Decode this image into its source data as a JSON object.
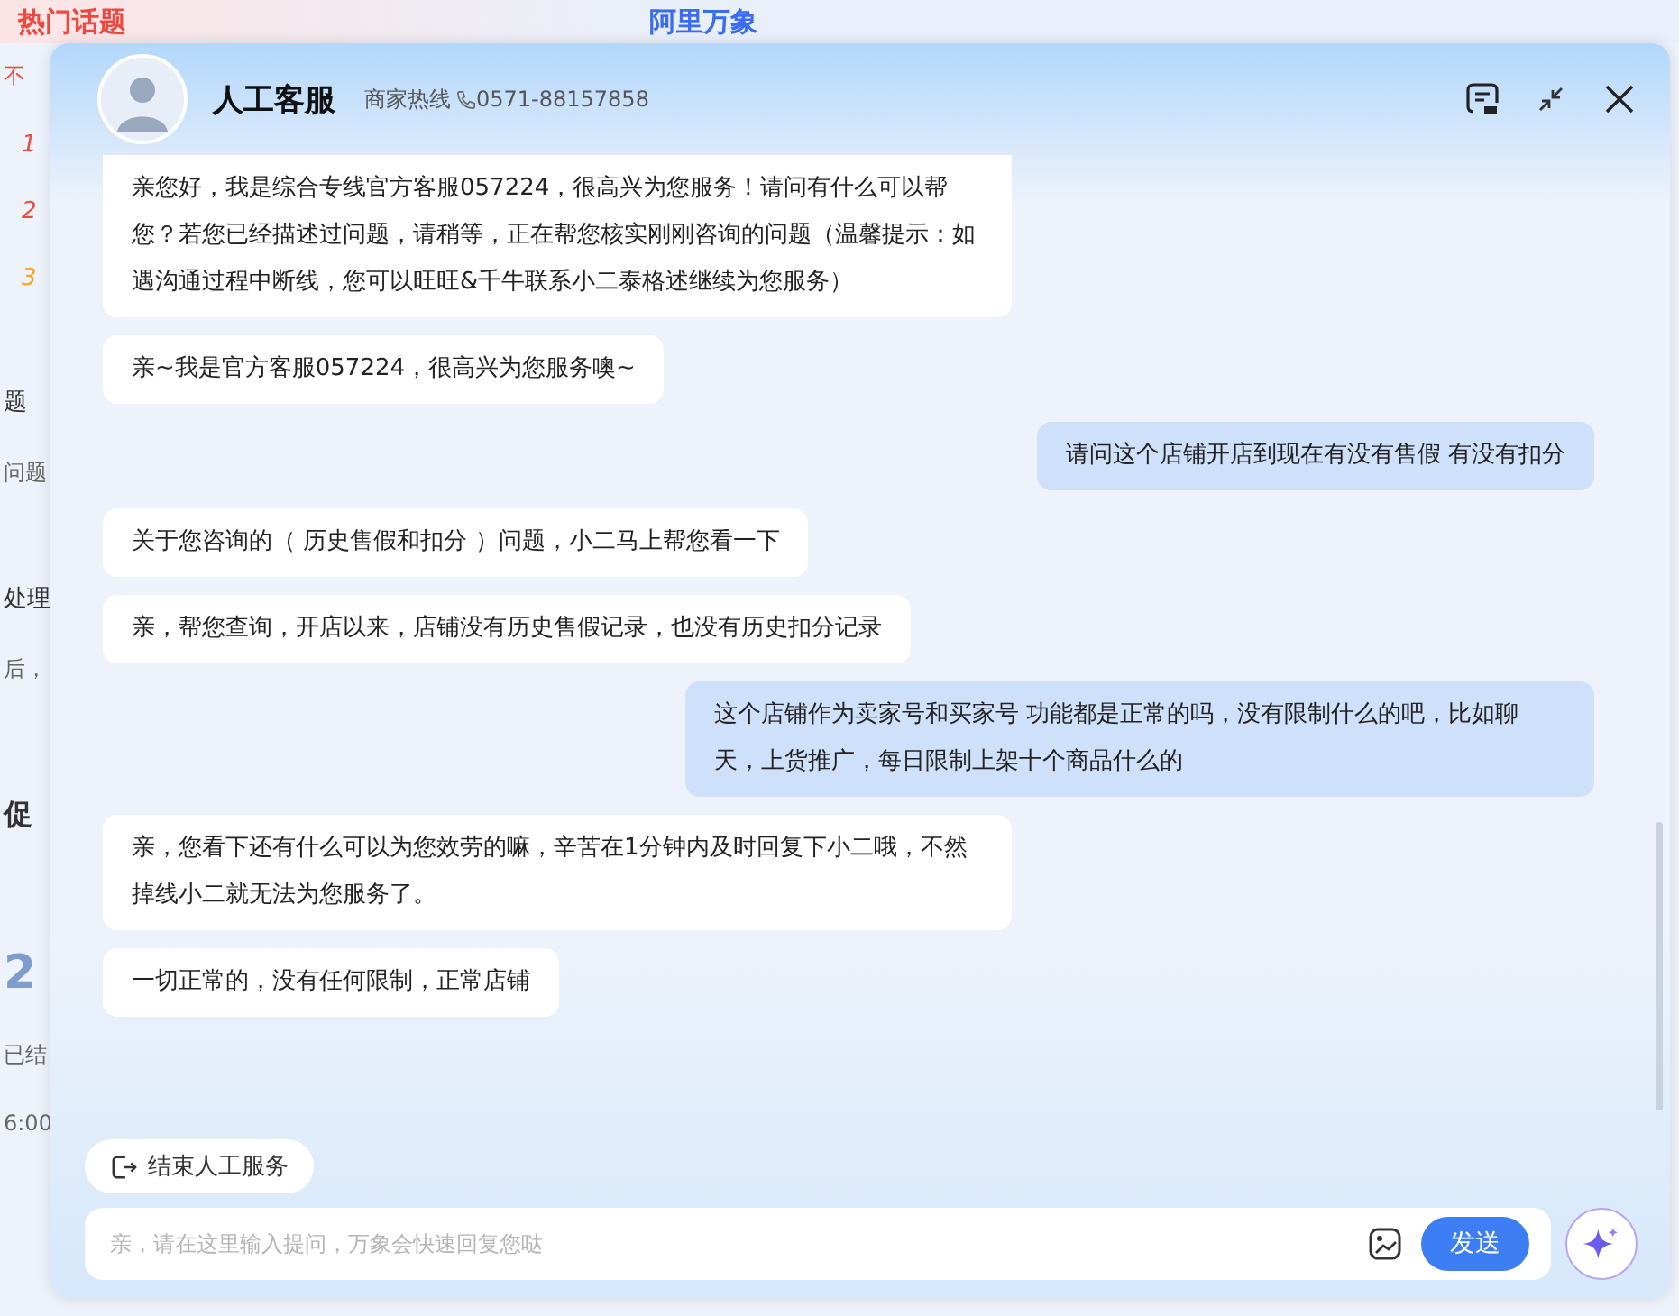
{
  "background": {
    "top_texts": [
      "热门话题",
      "阿里万象"
    ],
    "side_items": [
      {
        "kind": "hot",
        "text": "不"
      },
      {
        "kind": "rank",
        "text": "1",
        "color": "#f0483e"
      },
      {
        "kind": "rank",
        "text": "2",
        "color": "#f0483e"
      },
      {
        "kind": "rank",
        "text": "3",
        "color": "#f5a623"
      },
      {
        "kind": "title",
        "text": "题"
      },
      {
        "kind": "sub",
        "text": "问题"
      },
      {
        "kind": "title",
        "text": "处理"
      },
      {
        "kind": "sub",
        "text": "后，"
      },
      {
        "kind": "heading",
        "text": "促"
      },
      {
        "kind": "big",
        "text": "2"
      },
      {
        "kind": "sub",
        "text": "已结"
      },
      {
        "kind": "sub",
        "text": "6:00"
      }
    ]
  },
  "dialog": {
    "title": "人工客服",
    "hotline_label": "商家热线",
    "hotline": "0571-88157858"
  },
  "messages": [
    {
      "kind": "agent",
      "text": "亲您好，我是综合专线官方客服057224，很高兴为您服务！请问有什么可以帮您？若您已经描述过问题，请稍等，正在帮您核实刚刚咨询的问题（温馨提示：如遇沟通过程中断线，您可以旺旺&千牛联系小二泰格述继续为您服务）"
    },
    {
      "kind": "agent",
      "text": "亲~我是官方客服057224，很高兴为您服务噢~"
    },
    {
      "kind": "user",
      "text": "请问这个店铺开店到现在有没有售假 有没有扣分"
    },
    {
      "kind": "agent",
      "text": "关于您咨询的（ 历史售假和扣分 ）问题，小二马上帮您看一下"
    },
    {
      "kind": "agent",
      "text": "亲，帮您查询，开店以来，店铺没有历史售假记录，也没有历史扣分记录"
    },
    {
      "kind": "user",
      "text": "这个店铺作为卖家号和买家号 功能都是正常的吗，没有限制什么的吧，比如聊天，上货推广，每日限制上架十个商品什么的"
    },
    {
      "kind": "agent",
      "text": "亲，您看下还有什么可以为您效劳的嘛，辛苦在1分钟内及时回复下小二哦，不然掉线小二就无法为您服务了。"
    },
    {
      "kind": "agent",
      "text": "一切正常的，没有任何限制，正常店铺"
    }
  ],
  "end_button": "结束人工服务",
  "input": {
    "placeholder": "亲，请在这里输入提问，万象会快速回复您哒"
  },
  "send_button": "发送"
}
